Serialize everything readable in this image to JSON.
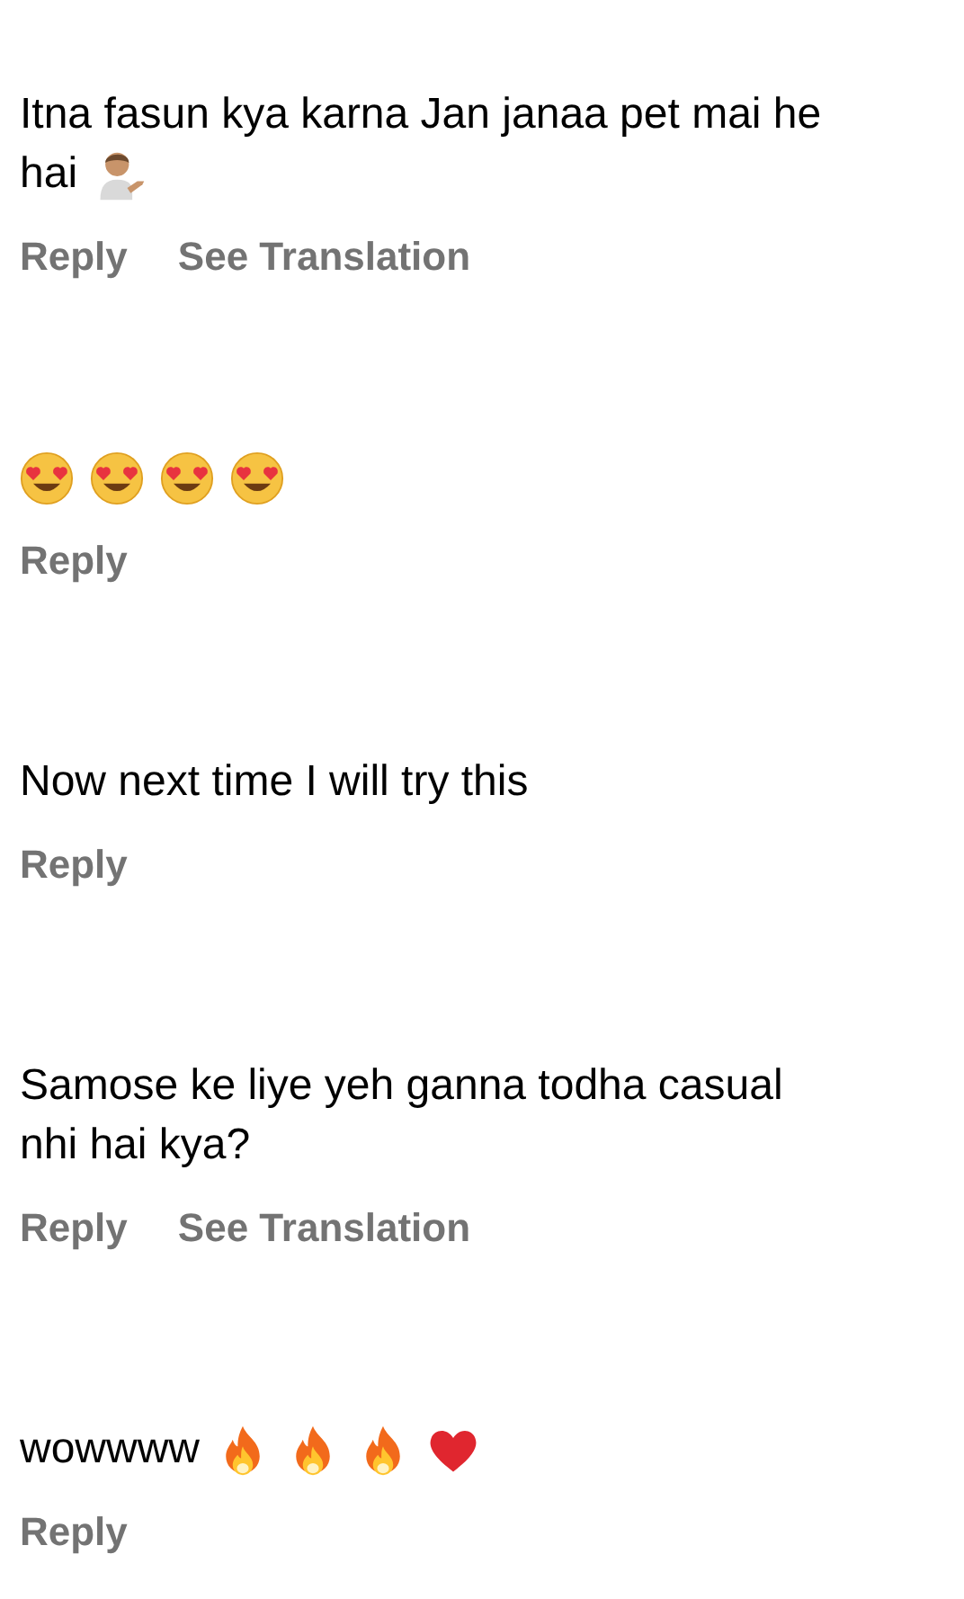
{
  "comments": [
    {
      "lines": [
        [
          {
            "kind": "text",
            "text": "Itna fasun kya karna Jan janaa pet mai he"
          }
        ],
        [
          {
            "kind": "text",
            "text": "hai"
          },
          {
            "kind": "person-tipping-hand"
          }
        ]
      ],
      "actions": [
        "Reply",
        "See Translation"
      ]
    },
    {
      "lines": [
        [
          {
            "kind": "heart-eyes"
          },
          {
            "kind": "heart-eyes"
          },
          {
            "kind": "heart-eyes"
          },
          {
            "kind": "heart-eyes"
          }
        ]
      ],
      "actions": [
        "Reply"
      ]
    },
    {
      "lines": [
        [
          {
            "kind": "text",
            "text": "Now next time I will try this"
          }
        ]
      ],
      "actions": [
        "Reply"
      ]
    },
    {
      "lines": [
        [
          {
            "kind": "text",
            "text": "Samose ke liye yeh ganna todha casual"
          }
        ],
        [
          {
            "kind": "text",
            "text": "nhi hai kya?"
          }
        ]
      ],
      "actions": [
        "Reply",
        "See Translation"
      ]
    },
    {
      "lines": [
        [
          {
            "kind": "text",
            "text": "wowwww"
          },
          {
            "kind": "fire"
          },
          {
            "kind": "fire"
          },
          {
            "kind": "fire"
          },
          {
            "kind": "heart"
          }
        ]
      ],
      "actions": [
        "Reply"
      ]
    }
  ]
}
